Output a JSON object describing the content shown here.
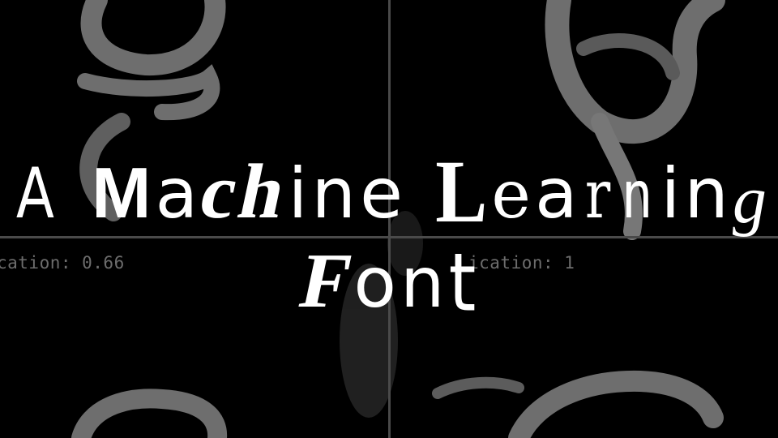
{
  "title": {
    "line1": {
      "word1": [
        "A"
      ],
      "word2": [
        "M",
        "a",
        "c",
        "h",
        "i",
        "n",
        "e"
      ],
      "word3": [
        "L",
        "e",
        "a",
        "r",
        "n",
        "i",
        "n",
        "g"
      ]
    },
    "line2": {
      "word1": [
        "F",
        "o",
        "n",
        "t"
      ]
    }
  },
  "readouts": {
    "left": "cation: 0.66",
    "right": "ication: 1"
  },
  "colors": {
    "background": "#000000",
    "background_glyphs": "#6e6e6e",
    "grid": "#4a4a4a",
    "title": "#ffffff"
  }
}
